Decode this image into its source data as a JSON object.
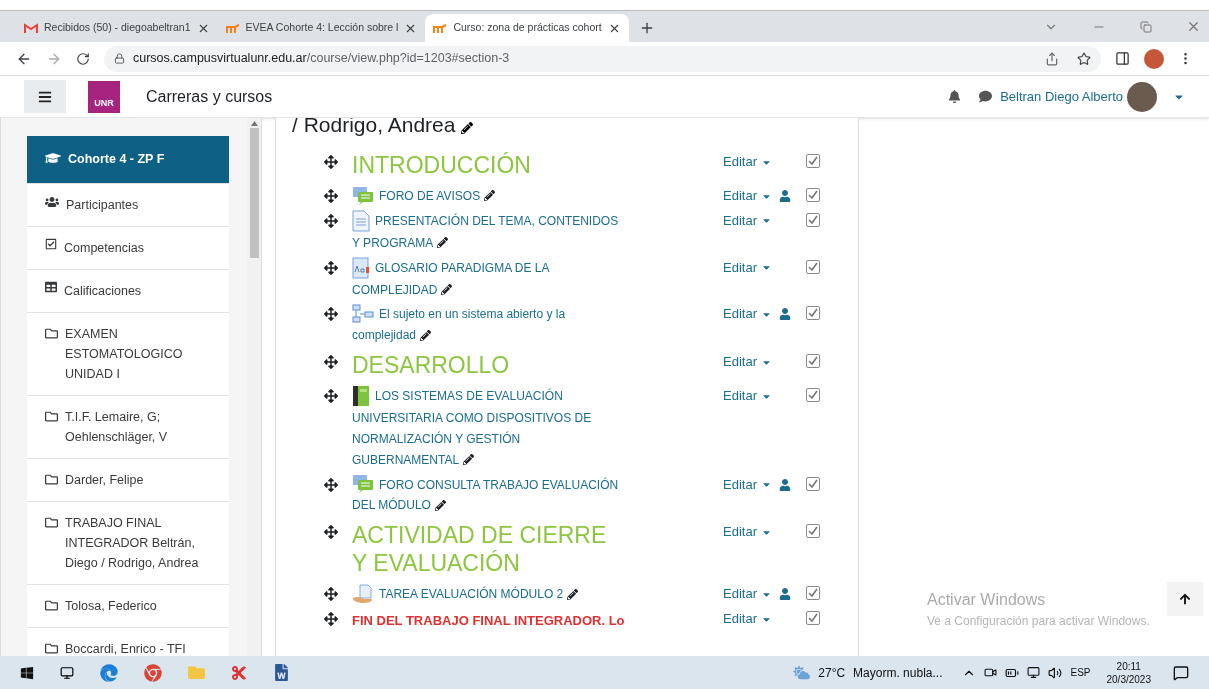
{
  "browser": {
    "tabs": [
      {
        "kind": "mail",
        "title": "Recibidos (50) - diegoabeltran1",
        "selected": false
      },
      {
        "kind": "moodle",
        "title": "EVEA Cohorte 4: Lección sobre l",
        "selected": false
      },
      {
        "kind": "moodle",
        "title": "Curso: zona de prácticas cohort",
        "selected": true
      }
    ],
    "url_host": "cursos.campusvirtualunr.edu.ar",
    "url_path": "/course/view.php?id=1203#section-3"
  },
  "navbar": {
    "logo": "UNR",
    "site_title": "Carreras y cursos",
    "user_name": "Beltran Diego Alberto"
  },
  "sidebar": {
    "items": [
      {
        "kind": "course",
        "label": "Cohorte 4 - ZP F",
        "selected": true
      },
      {
        "kind": "participants",
        "label": "Participantes",
        "selected": false
      },
      {
        "kind": "competencies",
        "label": "Competencias",
        "selected": false
      },
      {
        "kind": "grades",
        "label": "Calificaciones",
        "selected": false
      },
      {
        "kind": "folder",
        "label": "EXAMEN ESTOMATOLOGICO UNIDAD I",
        "selected": false
      },
      {
        "kind": "folder",
        "label": "T.I.F. Lemaire, G; Oehlenschläger, V",
        "selected": false
      },
      {
        "kind": "folder",
        "label": "Darder, Felipe",
        "selected": false
      },
      {
        "kind": "folder",
        "label": "TRABAJO FINAL INTEGRADOR Beltrán, Diego / Rodrigo, Andrea",
        "selected": false
      },
      {
        "kind": "folder",
        "label": "Tolosa, Federico",
        "selected": false
      },
      {
        "kind": "folder",
        "label": "Boccardi, Enrico - TFI",
        "selected": false
      }
    ]
  },
  "course": {
    "heading": "/ Rodrigo, Andrea",
    "items": [
      {
        "kind": "section",
        "title": "INTRODUCCIÓN",
        "edit": "Editar",
        "group": false,
        "checked": true
      },
      {
        "kind": "forum",
        "title": "FORO DE AVISOS",
        "edit": "Editar",
        "group": true,
        "checked": true
      },
      {
        "kind": "page",
        "title": "PRESENTACIÓN DEL TEMA, CONTENIDOS Y PROGRAMA",
        "edit": "Editar",
        "group": false,
        "checked": true
      },
      {
        "kind": "glossary",
        "title": "GLOSARIO PARADIGMA DE LA COMPLEJIDAD",
        "edit": "Editar",
        "group": false,
        "checked": true
      },
      {
        "kind": "map",
        "title": "El sujeto en un sistema abierto y la complejidad",
        "edit": "Editar",
        "group": true,
        "checked": true
      },
      {
        "kind": "section",
        "title": "DESARROLLO",
        "edit": "Editar",
        "group": false,
        "checked": true
      },
      {
        "kind": "book",
        "title": "LOS SISTEMAS DE EVALUACIÓN UNIVERSITARIA COMO DISPOSITIVOS DE NORMALIZACIÓN Y GESTIÓN GUBERNAMENTAL",
        "edit": "Editar",
        "group": false,
        "checked": true
      },
      {
        "kind": "forum",
        "title": "FORO CONSULTA TRABAJO EVALUACIÓN DEL MÓDULO",
        "edit": "Editar",
        "group": true,
        "checked": true
      },
      {
        "kind": "section",
        "title": "ACTIVIDAD DE CIERRE Y EVALUACIÓN",
        "edit": "Editar",
        "group": false,
        "checked": true
      },
      {
        "kind": "assign",
        "title": "TAREA EVALUACIÓN MÓDULO 2",
        "edit": "Editar",
        "group": true,
        "checked": true
      },
      {
        "kind": "label",
        "title": "FIN DEL TRABAJO FINAL INTEGRADOR. Lo",
        "edit": "Editar",
        "group": false,
        "checked": true
      }
    ]
  },
  "activation": {
    "title": "Activar Windows",
    "text": "Ve a Configuración para activar Windows."
  },
  "taskbar": {
    "temperature": "27°C",
    "weather": "Mayorm. nubla...",
    "language": "ESP",
    "time": "20:11",
    "date": "20/3/2023"
  }
}
